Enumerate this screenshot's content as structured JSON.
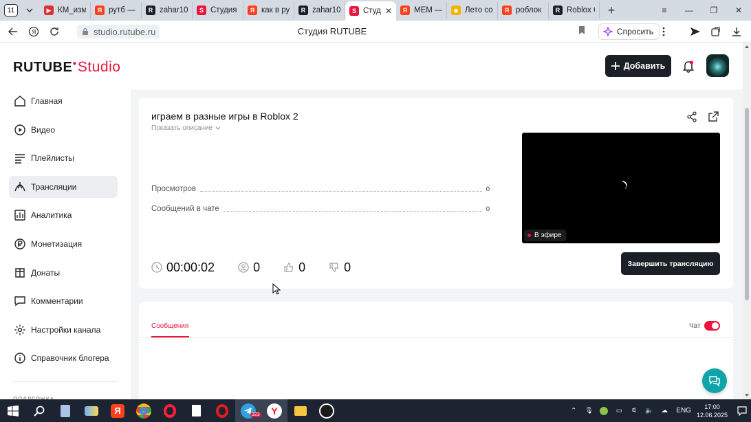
{
  "browser": {
    "tab_count": "11",
    "tabs": [
      {
        "title": "КМ_изме",
        "color": "#e02f2f",
        "glyph": "▶"
      },
      {
        "title": "рутб —",
        "color": "#fc3f1d",
        "glyph": "Я"
      },
      {
        "title": "zahar10",
        "color": "#1b1f26",
        "glyph": "R"
      },
      {
        "title": "Студия",
        "color": "#ed143b",
        "glyph": "S"
      },
      {
        "title": "как в ру",
        "color": "#fc3f1d",
        "glyph": "Я"
      },
      {
        "title": "zahar10",
        "color": "#1b1f26",
        "glyph": "R"
      },
      {
        "title": "Студ",
        "color": "#ed143b",
        "glyph": "S",
        "active": true
      },
      {
        "title": "MEM —",
        "color": "#fc3f1d",
        "glyph": "Я"
      },
      {
        "title": "Лето со",
        "color": "#f5b400",
        "glyph": "◆"
      },
      {
        "title": "роблок",
        "color": "#fc3f1d",
        "glyph": "Я"
      },
      {
        "title": "Roblox C",
        "color": "#1b1f26",
        "glyph": "R"
      }
    ],
    "url": "studio.rutube.ru",
    "page_title": "Студия RUTUBE",
    "ask_label": "Спросить"
  },
  "header": {
    "logo_main": "RUTUBE",
    "logo_studio": "Studio",
    "add_label": "Добавить"
  },
  "sidebar": {
    "items": [
      {
        "label": "Главная",
        "icon": "home-icon"
      },
      {
        "label": "Видео",
        "icon": "video-icon"
      },
      {
        "label": "Плейлисты",
        "icon": "playlist-icon"
      },
      {
        "label": "Трансляции",
        "icon": "broadcast-icon",
        "active": true
      },
      {
        "label": "Аналитика",
        "icon": "analytics-icon"
      },
      {
        "label": "Монетизация",
        "icon": "monetization-icon"
      },
      {
        "label": "Донаты",
        "icon": "donate-icon"
      },
      {
        "label": "Комментарии",
        "icon": "comments-icon"
      },
      {
        "label": "Настройки канала",
        "icon": "settings-icon"
      },
      {
        "label": "Справочник блогера",
        "icon": "info-icon"
      }
    ],
    "more_label": "ПОДДЕРЖКА"
  },
  "stream": {
    "title": "играем в разные игры в Roblox 2",
    "show_description": "Показать описание",
    "stats": [
      {
        "label": "Просмотров",
        "value": "0"
      },
      {
        "label": "Сообщений в чате",
        "value": "0"
      }
    ],
    "live_label": "В эфире",
    "timer": "00:00:02",
    "viewers": "0",
    "likes": "0",
    "dislikes": "0",
    "finish_label": "Завершить трансляцию"
  },
  "chat": {
    "tab_label": "Сообщения",
    "toggle_label": "Чат",
    "toggle_on": true
  },
  "taskbar": {
    "telegram_badge": "323",
    "lang": "ENG",
    "time": "17:00",
    "date": "12.06.2025"
  },
  "colors": {
    "accent": "#ed143b",
    "dark_button": "#1b1f26",
    "help_fab": "#0fa5a8"
  }
}
